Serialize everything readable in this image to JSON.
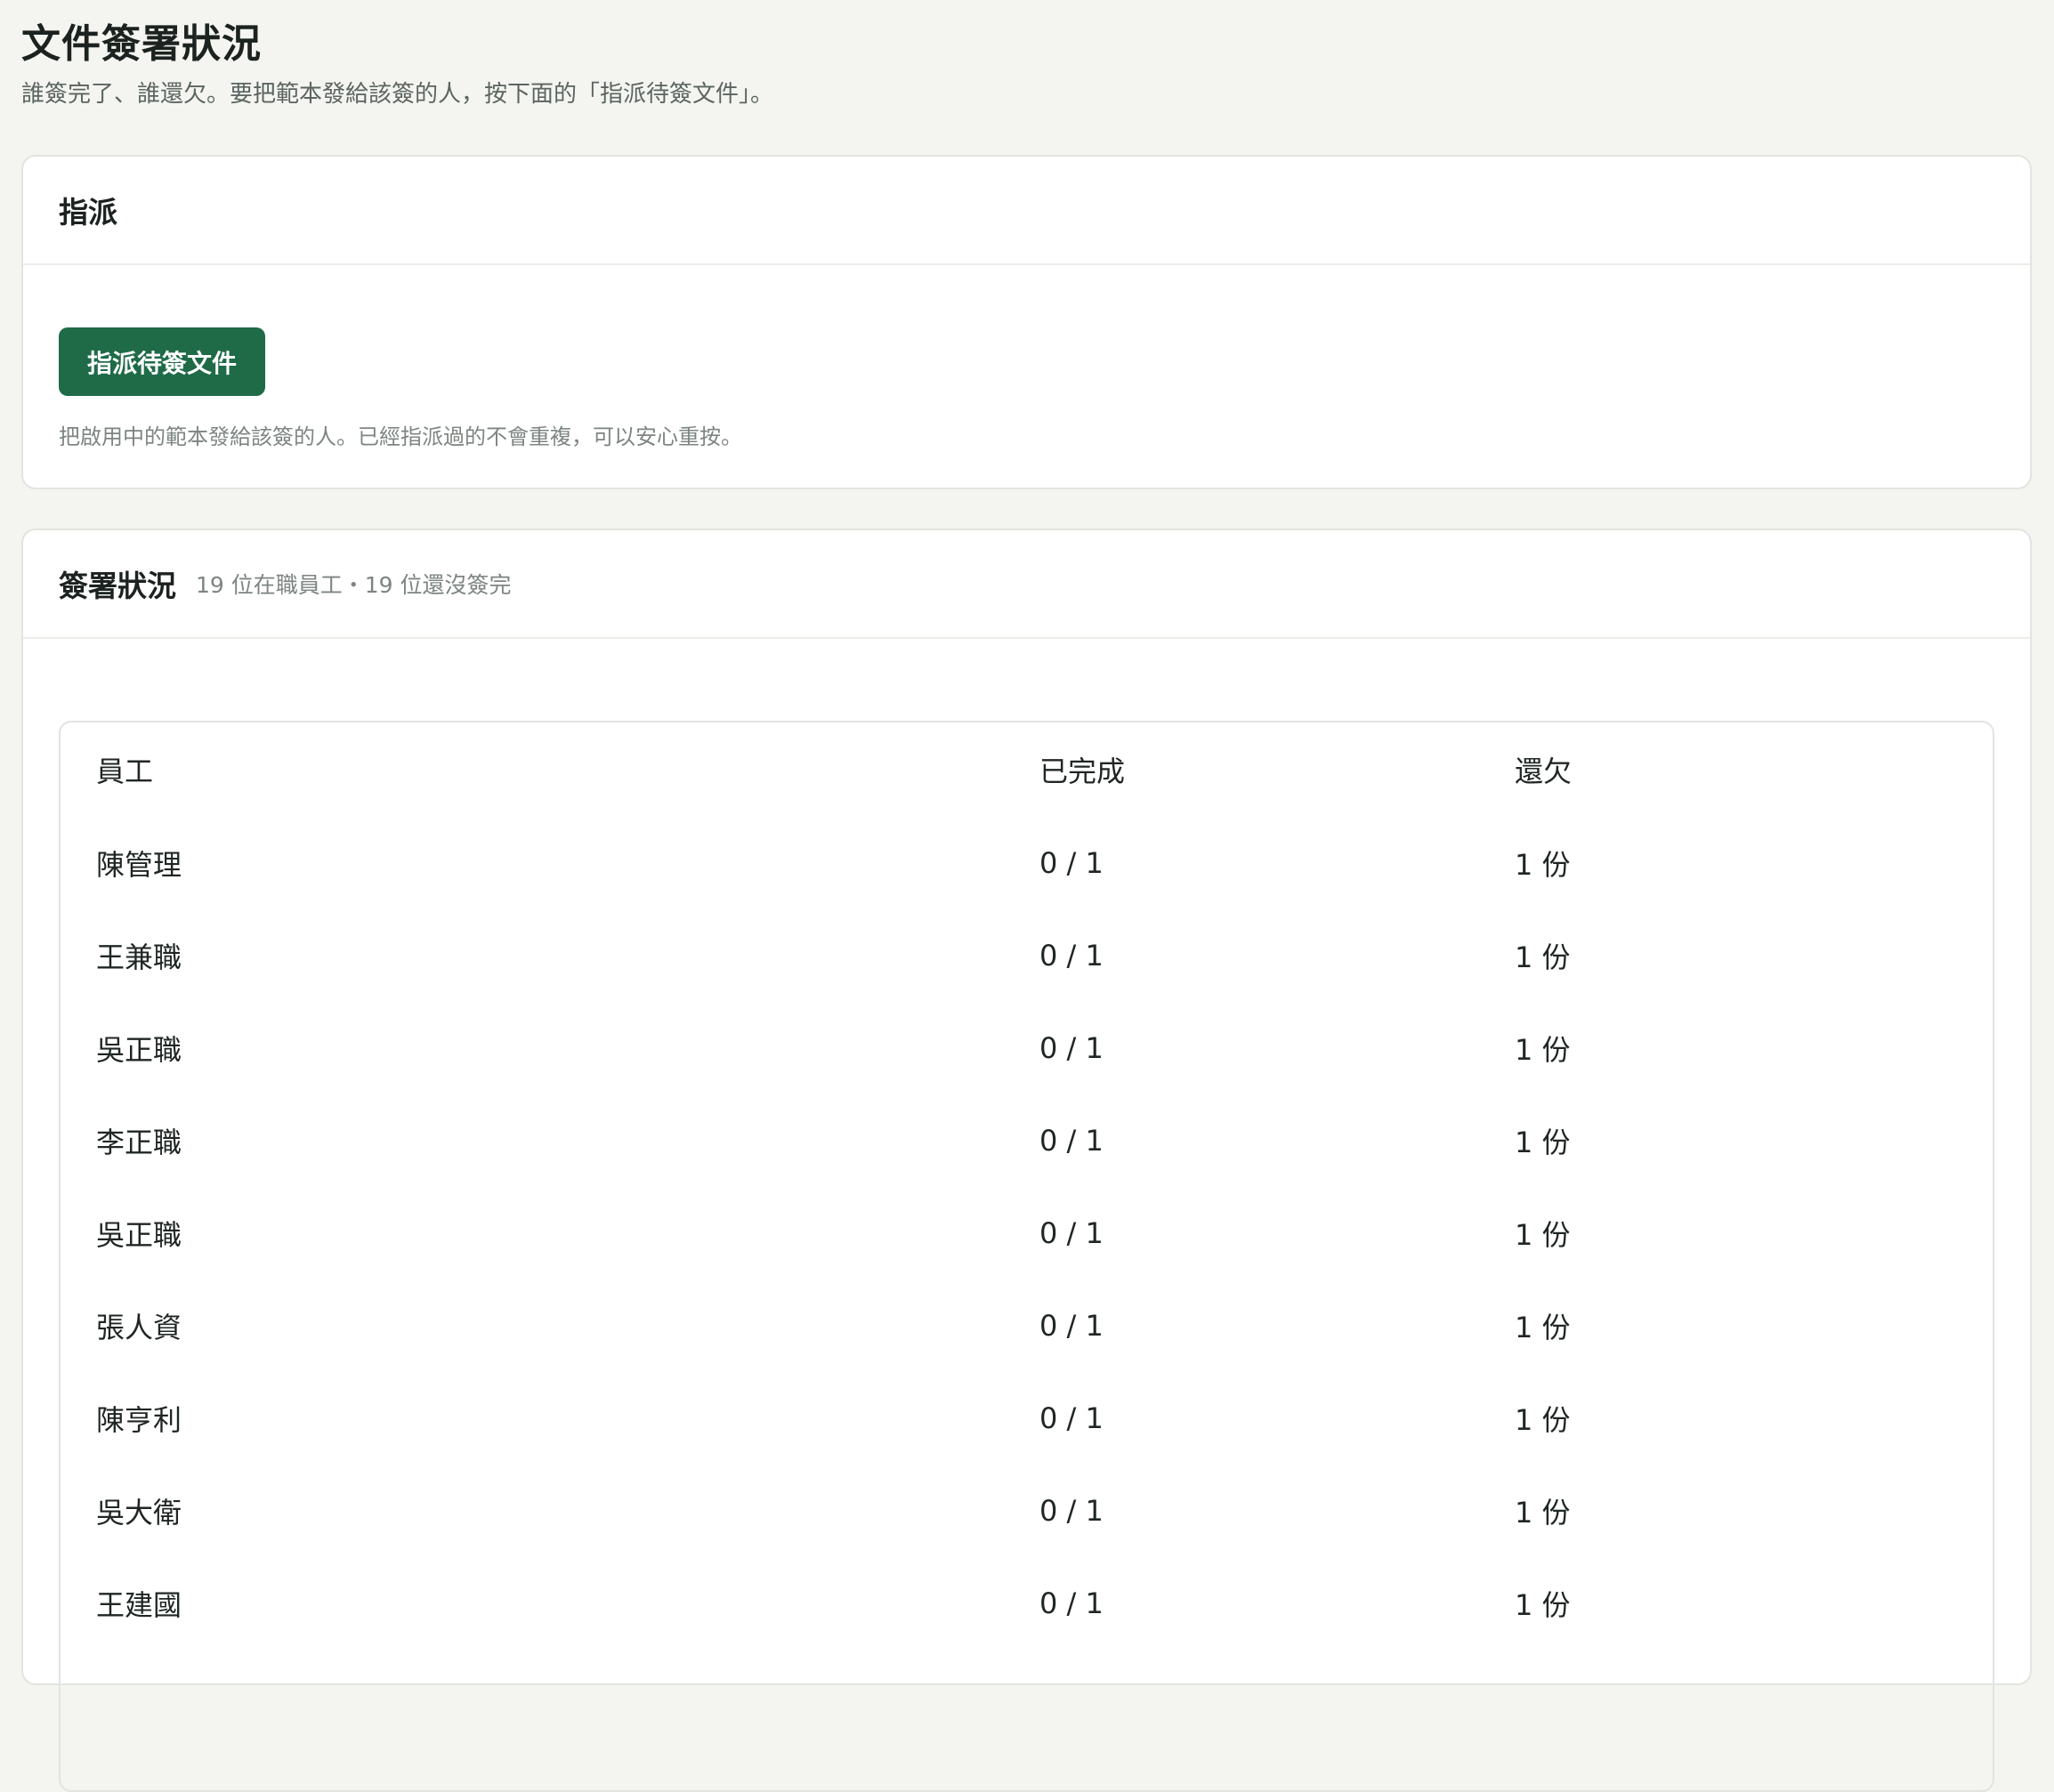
{
  "header": {
    "title": "文件簽署狀況",
    "subtitle": "誰簽完了、誰還欠。要把範本發給該簽的人，按下面的「指派待簽文件」。"
  },
  "assign_card": {
    "title": "指派",
    "button_label": "指派待簽文件",
    "hint": "把啟用中的範本發給該簽的人。已經指派過的不會重複，可以安心重按。"
  },
  "status_card": {
    "title": "簽署狀況",
    "meta": "19 位在職員工・19 位還沒簽完",
    "columns": [
      "員工",
      "已完成",
      "還欠"
    ],
    "rows": [
      {
        "name": "陳管理",
        "done": "0 / 1",
        "owe": "1 份"
      },
      {
        "name": "王兼職",
        "done": "0 / 1",
        "owe": "1 份"
      },
      {
        "name": "吳正職",
        "done": "0 / 1",
        "owe": "1 份"
      },
      {
        "name": "李正職",
        "done": "0 / 1",
        "owe": "1 份"
      },
      {
        "name": "吳正職",
        "done": "0 / 1",
        "owe": "1 份"
      },
      {
        "name": "張人資",
        "done": "0 / 1",
        "owe": "1 份"
      },
      {
        "name": "陳亨利",
        "done": "0 / 1",
        "owe": "1 份"
      },
      {
        "name": "吳大衛",
        "done": "0 / 1",
        "owe": "1 份"
      },
      {
        "name": "王建國",
        "done": "0 / 1",
        "owe": "1 份"
      }
    ]
  },
  "colors": {
    "primary_button": "#1f6b48",
    "page_background": "#f4f5f1"
  }
}
